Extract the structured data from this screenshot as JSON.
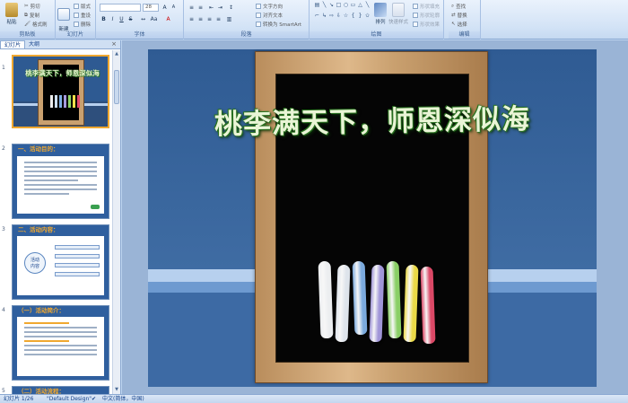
{
  "ribbon": {
    "clipboard": {
      "paste": "粘贴",
      "cut": "剪切",
      "copy": "复制",
      "format_painter": "格式刷",
      "group": "剪贴板"
    },
    "slides": {
      "new_slide": "新建\n幻灯片",
      "layout": "版式",
      "reset": "重设",
      "delete": "删除",
      "group": "幻灯片"
    },
    "font": {
      "font_value": "",
      "size_value": "28",
      "group": "字体"
    },
    "paragraph": {
      "text_direction": "文字方向",
      "align_text": "对齐文本",
      "smartart": "转换为 SmartArt",
      "group": "段落"
    },
    "drawing": {
      "arrange": "排列",
      "quick_styles": "快速样式",
      "shape_fill": "形状填充",
      "shape_outline": "形状轮廓",
      "shape_effects": "形状效果",
      "group": "绘图"
    },
    "editing": {
      "find": "查找",
      "replace": "替换",
      "select": "选择",
      "group": "编辑"
    }
  },
  "panel": {
    "tab_slides": "幻灯片",
    "tab_outline": "大纲"
  },
  "thumbnails": [
    {
      "num": "1",
      "title": "桃李满天下，师恩深似海"
    },
    {
      "num": "2",
      "title": "一、活动目的："
    },
    {
      "num": "3",
      "title": "二、活动内容：",
      "center": "活动\n内容"
    },
    {
      "num": "4",
      "title": "（一）活动简介："
    },
    {
      "num": "5",
      "title": "（二）活动流程："
    }
  ],
  "slide": {
    "title": "桃李满天下，师恩深似海"
  },
  "chalk_colors": [
    "#f4f6f8",
    "#e6ecf3",
    "#7fb0e6",
    "#a59adf",
    "#8fd66a",
    "#f2e04a",
    "#e24b6a"
  ],
  "status": {
    "slide_count": "幻灯片 1/26",
    "theme": "\"Default Design\"",
    "language": "中文(简体，中国)"
  }
}
